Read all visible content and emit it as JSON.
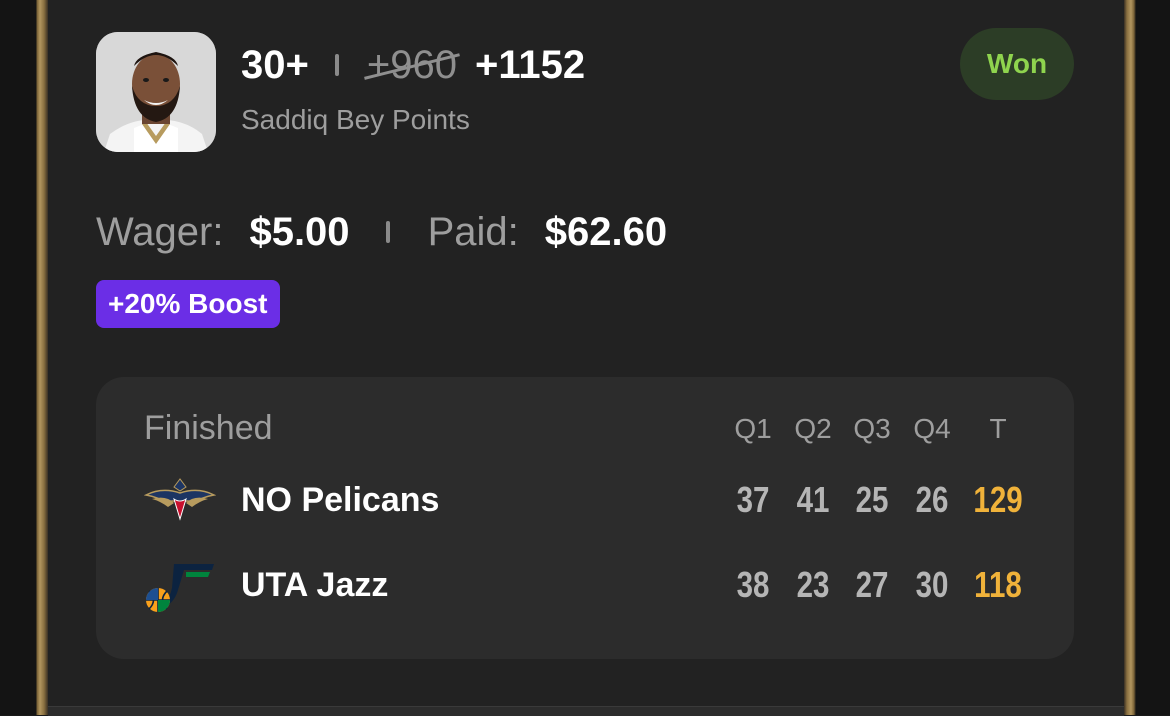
{
  "bet": {
    "line": "30+",
    "old_odds": "+960",
    "boosted_odds": "+1152",
    "market": "Saddiq Bey Points",
    "result": "Won",
    "player_avatar_icon": "player-headshot"
  },
  "wager": {
    "wager_label": "Wager:",
    "wager_amount": "$5.00",
    "paid_label": "Paid:",
    "paid_amount": "$62.60"
  },
  "boost": {
    "label": "+20% Boost",
    "color": "#6b2ee6"
  },
  "colors": {
    "won_text": "#8fd44e",
    "won_bg": "#2c3d26",
    "total": "#f0b23a"
  },
  "scoreboard": {
    "status": "Finished",
    "headers": [
      "Q1",
      "Q2",
      "Q3",
      "Q4",
      "T"
    ],
    "teams": [
      {
        "name": "NO Pelicans",
        "logo_icon": "pelicans-logo-icon",
        "scores": [
          "37",
          "41",
          "25",
          "26"
        ],
        "total": "129"
      },
      {
        "name": "UTA Jazz",
        "logo_icon": "jazz-logo-icon",
        "scores": [
          "38",
          "23",
          "27",
          "30"
        ],
        "total": "118"
      }
    ]
  }
}
